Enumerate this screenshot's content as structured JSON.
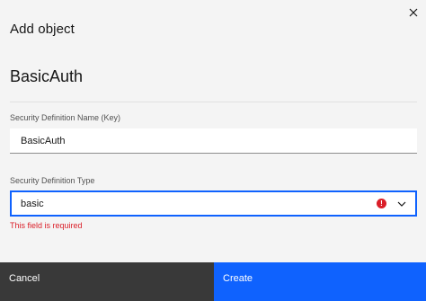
{
  "modal": {
    "header_label": "Add object",
    "title": "BasicAuth"
  },
  "name_field": {
    "label": "Security Definition Name (Key)",
    "value": "BasicAuth"
  },
  "type_field": {
    "label": "Security Definition Type",
    "selected": "basic",
    "error": "This field is required",
    "error_icon": "!"
  },
  "footer": {
    "cancel_label": "Cancel",
    "create_label": "Create"
  },
  "colors": {
    "primary": "#0f62fe",
    "danger": "#da1e28",
    "secondary": "#393939",
    "background": "#f4f4f4"
  },
  "icons": {
    "close": "close-icon",
    "error": "error-icon",
    "dropdown": "chevron-down-icon"
  }
}
